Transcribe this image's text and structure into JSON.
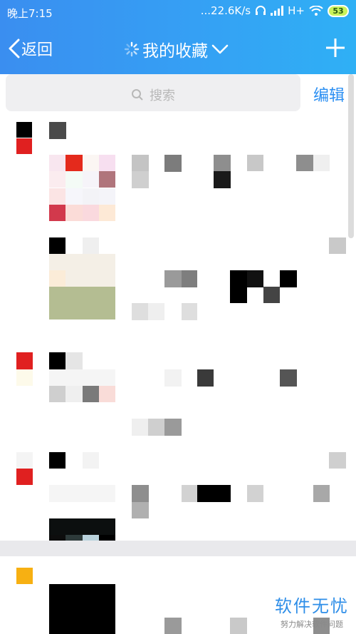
{
  "status_bar": {
    "time": "晚上7:15",
    "network_speed": "...22.6K/s",
    "network_type": "H+",
    "battery": "53"
  },
  "nav": {
    "back_label": "返回",
    "title": "我的收藏"
  },
  "search": {
    "placeholder": "搜索"
  },
  "edit_label": "编辑",
  "watermark": {
    "main": "软件无忧",
    "sub": "努力解决软件问题"
  },
  "colors": {
    "header_start": "#3a8ef0",
    "header_end": "#2fb0f5",
    "accent": "#2a8ef2",
    "battery": "#c9f25a"
  }
}
